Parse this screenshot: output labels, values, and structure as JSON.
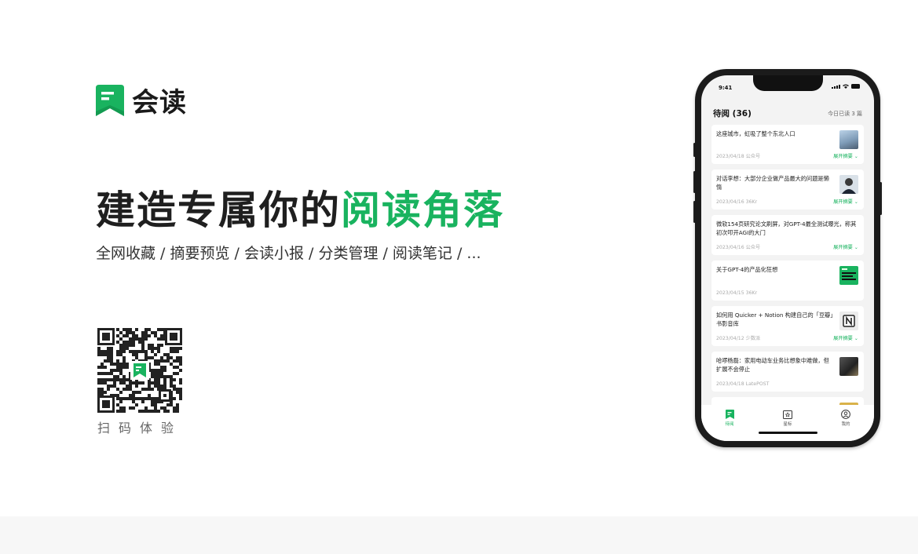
{
  "brand": {
    "name": "会读",
    "accent": "#19b35f"
  },
  "hero": {
    "headline_dark": "建造专属你的",
    "headline_green": "阅读角落",
    "features": "全网收藏 / 摘要预览 / 会读小报 / 分类管理 / 阅读笔记 / ..."
  },
  "qr": {
    "label": "扫码体验"
  },
  "phone": {
    "status_time": "9:41",
    "title": "待阅 (36)",
    "read_today": "今日已读 3 篇",
    "expand_label": "展开摘要",
    "articles": [
      {
        "title": "这座城市，虹吸了整个东北人口",
        "meta": "2023/04/18 公众号",
        "thumb": "city"
      },
      {
        "title": "对话李想：大部分企业做产品最大的问题是懒惰",
        "meta": "2023/04/16 36Kr",
        "thumb": "person"
      },
      {
        "title": "微软154页研究论文刷屏，对GPT-4最全测试曝光，称其初次叩开AGI的大门",
        "meta": "2023/04/16 公众号",
        "thumb": ""
      },
      {
        "title": "关于GPT-4的产品化狂想",
        "meta": "2023/04/15 36Kr",
        "thumb": "gpt"
      },
      {
        "title": "如何用 Quicker + Notion 构建自己的「豆瓣」书影音库",
        "meta": "2023/04/12 少数派",
        "thumb": "notion"
      },
      {
        "title": "哈啰杨磊：家用电动车业务比想象中难做，但扩展不会停止",
        "meta": "2023/04/18 LatePOST",
        "thumb": "bike"
      }
    ],
    "tabs": [
      {
        "label": "待阅",
        "icon": "bookmark-icon"
      },
      {
        "label": "星标",
        "icon": "star-folder-icon"
      },
      {
        "label": "我的",
        "icon": "profile-icon"
      }
    ]
  }
}
